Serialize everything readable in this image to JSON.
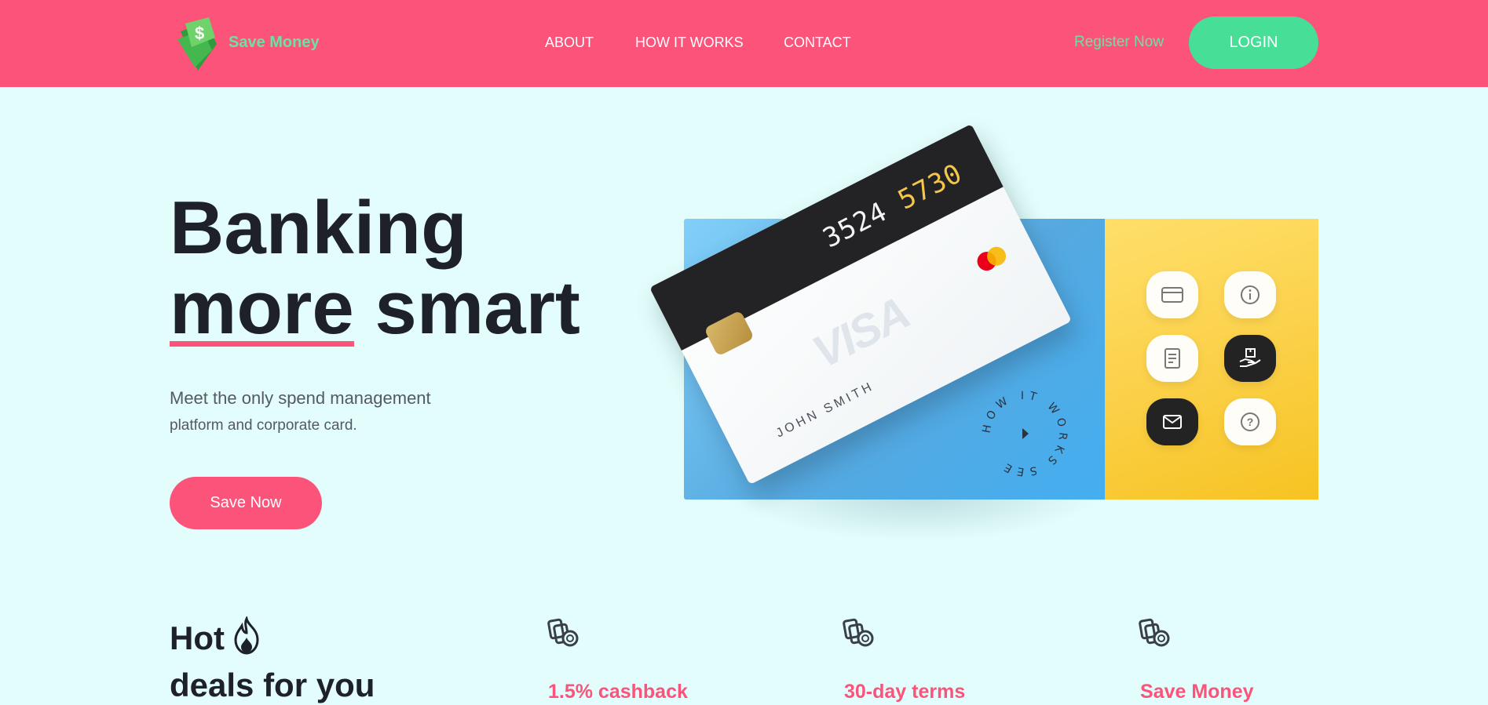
{
  "header": {
    "brand": "Save Money",
    "nav": [
      {
        "label": "ABOUT"
      },
      {
        "label": "HOW IT WORKS"
      },
      {
        "label": "CONTACT"
      }
    ],
    "register_label": "Register Now",
    "login_label": "LOGIN"
  },
  "hero": {
    "title_line1": "Banking",
    "title_word_underlined": "more",
    "title_word_rest": " smart",
    "subtitle_line1": "Meet the only spend management",
    "subtitle_line2": "platform and corporate card.",
    "cta_label": "Save Now",
    "card": {
      "number_part1": "3524",
      "number_part2": "5730",
      "brand": "VISA",
      "holder": "JOHN SMITH"
    },
    "badge_text": "HOW IT WORKS SEE",
    "app_icons": [
      "card-icon",
      "info-icon",
      "document-icon",
      "hand-package-icon",
      "mail-icon",
      "help-icon"
    ]
  },
  "deals": {
    "title_line1": "Hot",
    "title_line2": "deals for you",
    "items": [
      {
        "title": "1.5% cashback",
        "icon": "coins-icon"
      },
      {
        "title": "30-day terms",
        "icon": "coins-icon"
      },
      {
        "title": "Save Money",
        "icon": "coins-icon"
      }
    ]
  },
  "colors": {
    "header_bg": "#fb5379",
    "accent_green": "#47df97",
    "page_bg": "#e2fdfb",
    "accent_pink": "#fb5379"
  }
}
